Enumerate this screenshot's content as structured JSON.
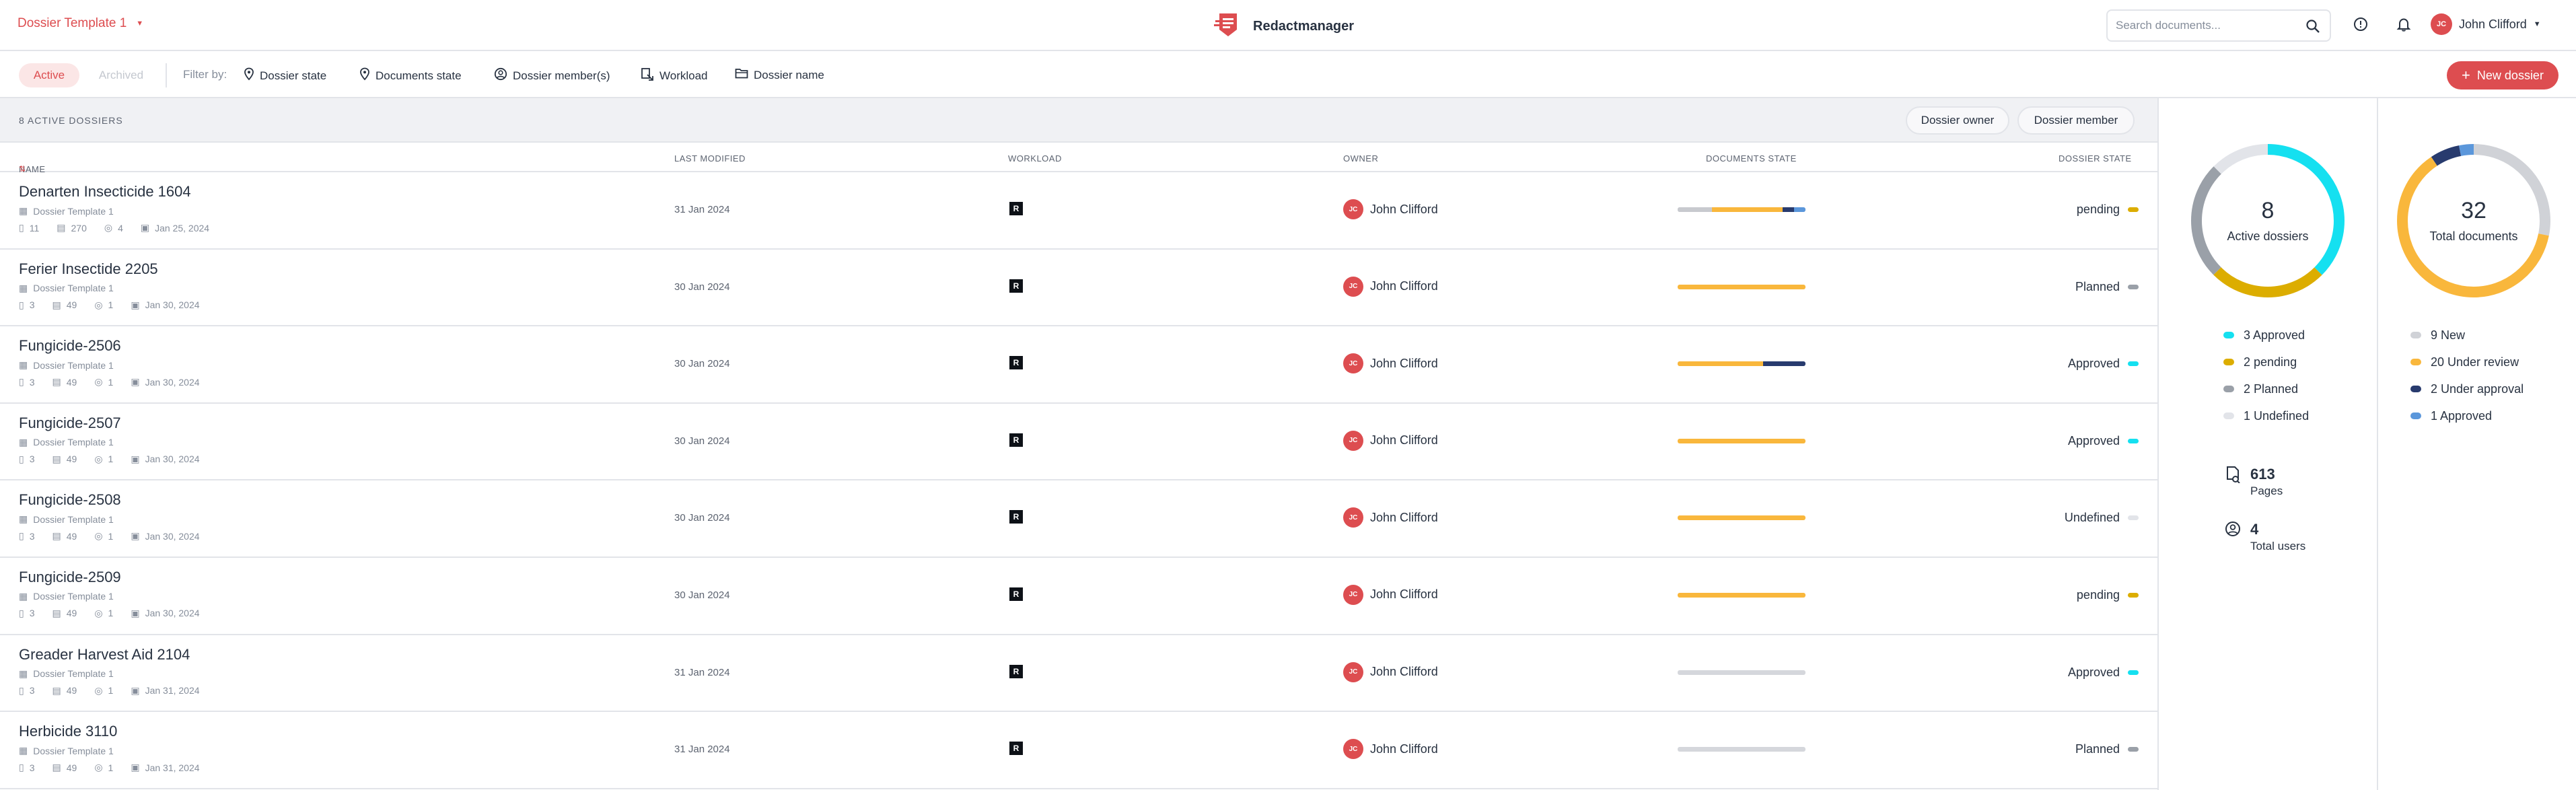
{
  "header": {
    "template_selector": "Dossier Template 1",
    "app_name": "Redactmanager",
    "search_placeholder": "Search documents...",
    "user_initials": "JC",
    "user_name": "John Clifford"
  },
  "filters": {
    "tab_active": "Active",
    "tab_archived": "Archived",
    "filter_by_label": "Filter by:",
    "items": [
      {
        "label": "Dossier state",
        "icon": "location-pin-icon"
      },
      {
        "label": "Documents state",
        "icon": "location-pin-icon"
      },
      {
        "label": "Dossier member(s)",
        "icon": "user-circle-icon"
      },
      {
        "label": "Workload",
        "icon": "workload-icon"
      },
      {
        "label": "Dossier name",
        "icon": "folder-icon"
      }
    ],
    "new_dossier": "New dossier"
  },
  "list": {
    "count_label": "8 ACTIVE DOSSIERS",
    "toggle_owner": "Dossier owner",
    "toggle_member": "Dossier member",
    "columns": {
      "name": "NAME",
      "last_modified": "LAST MODIFIED",
      "workload": "WORKLOAD",
      "owner": "OWNER",
      "documents_state": "DOCUMENTS STATE",
      "dossier_state": "DOSSIER STATE"
    },
    "rows": [
      {
        "name": "Denarten Insecticide 1604",
        "template": "Dossier Template 1",
        "docs": "11",
        "pages": "270",
        "members": "4",
        "due": "Jan 25, 2024",
        "modified": "31 Jan 2024",
        "workload": "R",
        "owner_initials": "JC",
        "owner": "John Clifford",
        "state": "pending",
        "state_color": "#dcad00",
        "doc_state": [
          {
            "color": "#c8cacf",
            "share": 0.27
          },
          {
            "color": "#f9b73c",
            "share": 0.55
          },
          {
            "color": "#283b6e",
            "share": 0.09
          },
          {
            "color": "#5b97db",
            "share": 0.09
          }
        ]
      },
      {
        "name": "Ferier Insectide 2205",
        "template": "Dossier Template 1",
        "docs": "3",
        "pages": "49",
        "members": "1",
        "due": "Jan 30, 2024",
        "modified": "30 Jan 2024",
        "workload": "R",
        "owner_initials": "JC",
        "owner": "John Clifford",
        "state": "Planned",
        "state_color": "#9aa0a8",
        "doc_state": [
          {
            "color": "#f9b73c",
            "share": 1
          }
        ]
      },
      {
        "name": "Fungicide-2506",
        "template": "Dossier Template 1",
        "docs": "3",
        "pages": "49",
        "members": "1",
        "due": "Jan 30, 2024",
        "modified": "30 Jan 2024",
        "workload": "R",
        "owner_initials": "JC",
        "owner": "John Clifford",
        "state": "Approved",
        "state_color": "#15e0f0",
        "doc_state": [
          {
            "color": "#f9b73c",
            "share": 0.67
          },
          {
            "color": "#283b6e",
            "share": 0.33
          }
        ]
      },
      {
        "name": "Fungicide-2507",
        "template": "Dossier Template 1",
        "docs": "3",
        "pages": "49",
        "members": "1",
        "due": "Jan 30, 2024",
        "modified": "30 Jan 2024",
        "workload": "R",
        "owner_initials": "JC",
        "owner": "John Clifford",
        "state": "Approved",
        "state_color": "#15e0f0",
        "doc_state": [
          {
            "color": "#f9b73c",
            "share": 1
          }
        ]
      },
      {
        "name": "Fungicide-2508",
        "template": "Dossier Template 1",
        "docs": "3",
        "pages": "49",
        "members": "1",
        "due": "Jan 30, 2024",
        "modified": "30 Jan 2024",
        "workload": "R",
        "owner_initials": "JC",
        "owner": "John Clifford",
        "state": "Undefined",
        "state_color": "#e2e4e9",
        "doc_state": [
          {
            "color": "#f9b73c",
            "share": 1
          }
        ]
      },
      {
        "name": "Fungicide-2509",
        "template": "Dossier Template 1",
        "docs": "3",
        "pages": "49",
        "members": "1",
        "due": "Jan 30, 2024",
        "modified": "30 Jan 2024",
        "workload": "R",
        "owner_initials": "JC",
        "owner": "John Clifford",
        "state": "pending",
        "state_color": "#dcad00",
        "doc_state": [
          {
            "color": "#f9b73c",
            "share": 1
          }
        ]
      },
      {
        "name": "Greader Harvest Aid 2104",
        "template": "Dossier Template 1",
        "docs": "3",
        "pages": "49",
        "members": "1",
        "due": "Jan 31, 2024",
        "modified": "31 Jan 2024",
        "workload": "R",
        "owner_initials": "JC",
        "owner": "John Clifford",
        "state": "Approved",
        "state_color": "#15e0f0",
        "doc_state": [
          {
            "color": "#d5d7dc",
            "share": 1
          }
        ]
      },
      {
        "name": "Herbicide 3110",
        "template": "Dossier Template 1",
        "docs": "3",
        "pages": "49",
        "members": "1",
        "due": "Jan 31, 2024",
        "modified": "31 Jan 2024",
        "workload": "R",
        "owner_initials": "JC",
        "owner": "John Clifford",
        "state": "Planned",
        "state_color": "#9aa0a8",
        "doc_state": [
          {
            "color": "#d5d7dc",
            "share": 1
          }
        ]
      }
    ]
  },
  "stats": {
    "dossiers": {
      "total": "8",
      "label": "Active dossiers",
      "legend": [
        {
          "label": "3 Approved",
          "value": 3,
          "color": "#15e0f0"
        },
        {
          "label": "2 pending",
          "value": 2,
          "color": "#dcad00"
        },
        {
          "label": "2 Planned",
          "value": 2,
          "color": "#9aa0a8"
        },
        {
          "label": "1 Undefined",
          "value": 1,
          "color": "#e2e4e9"
        }
      ]
    },
    "documents": {
      "total": "32",
      "label": "Total documents",
      "legend": [
        {
          "label": "9 New",
          "value": 9,
          "color": "#d0d2d7"
        },
        {
          "label": "20 Under review",
          "value": 20,
          "color": "#f9b73c"
        },
        {
          "label": "2 Under approval",
          "value": 2,
          "color": "#283b6e"
        },
        {
          "label": "1 Approved",
          "value": 1,
          "color": "#5b97db"
        }
      ]
    },
    "pages_value": "613",
    "pages_label": "Pages",
    "users_value": "4",
    "users_label": "Total users"
  }
}
